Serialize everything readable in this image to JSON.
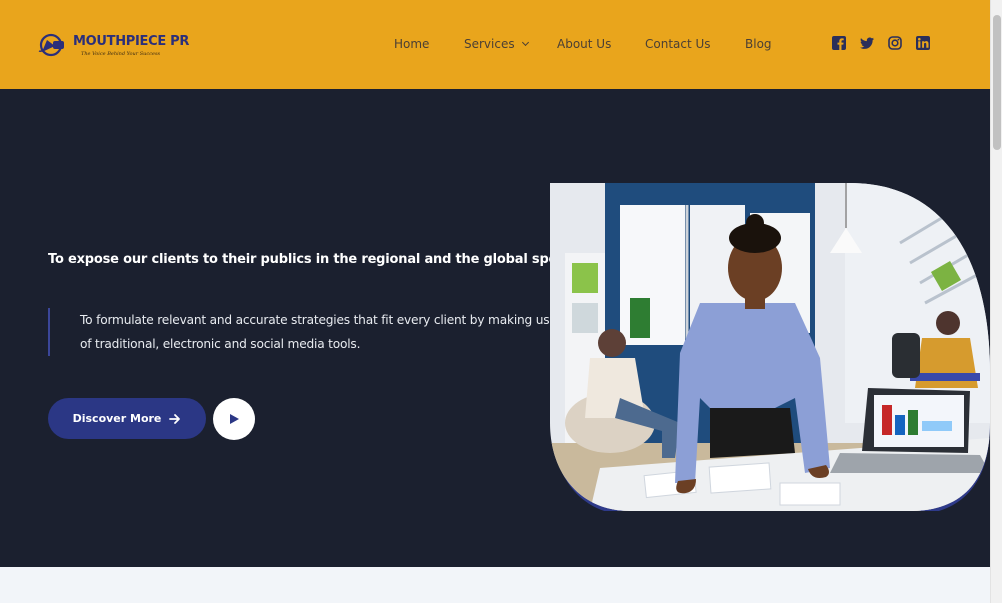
{
  "brand": {
    "name": "MOUTHPIECE PR",
    "tagline": "The Voice Behind Your Success",
    "colors": {
      "header": "#e9a51c",
      "hero": "#1b202f",
      "accent": "#2b3785",
      "text_nav": "#4a3f35"
    }
  },
  "nav": {
    "items": [
      {
        "label": "Home"
      },
      {
        "label": "Services"
      },
      {
        "label": "About Us"
      },
      {
        "label": "Contact Us"
      },
      {
        "label": "Blog"
      }
    ]
  },
  "social": [
    "facebook-icon",
    "twitter-icon",
    "instagram-icon",
    "linkedin-icon"
  ],
  "hero": {
    "title": "To expose our clients to their publics in the regional and the global spectrum",
    "text": "To formulate relevant and accurate strategies that fit every client by making use of traditional, electronic and social media tools.",
    "cta_label": "Discover More",
    "play_icon": "play-icon",
    "image_alt": "office-team-photo"
  }
}
